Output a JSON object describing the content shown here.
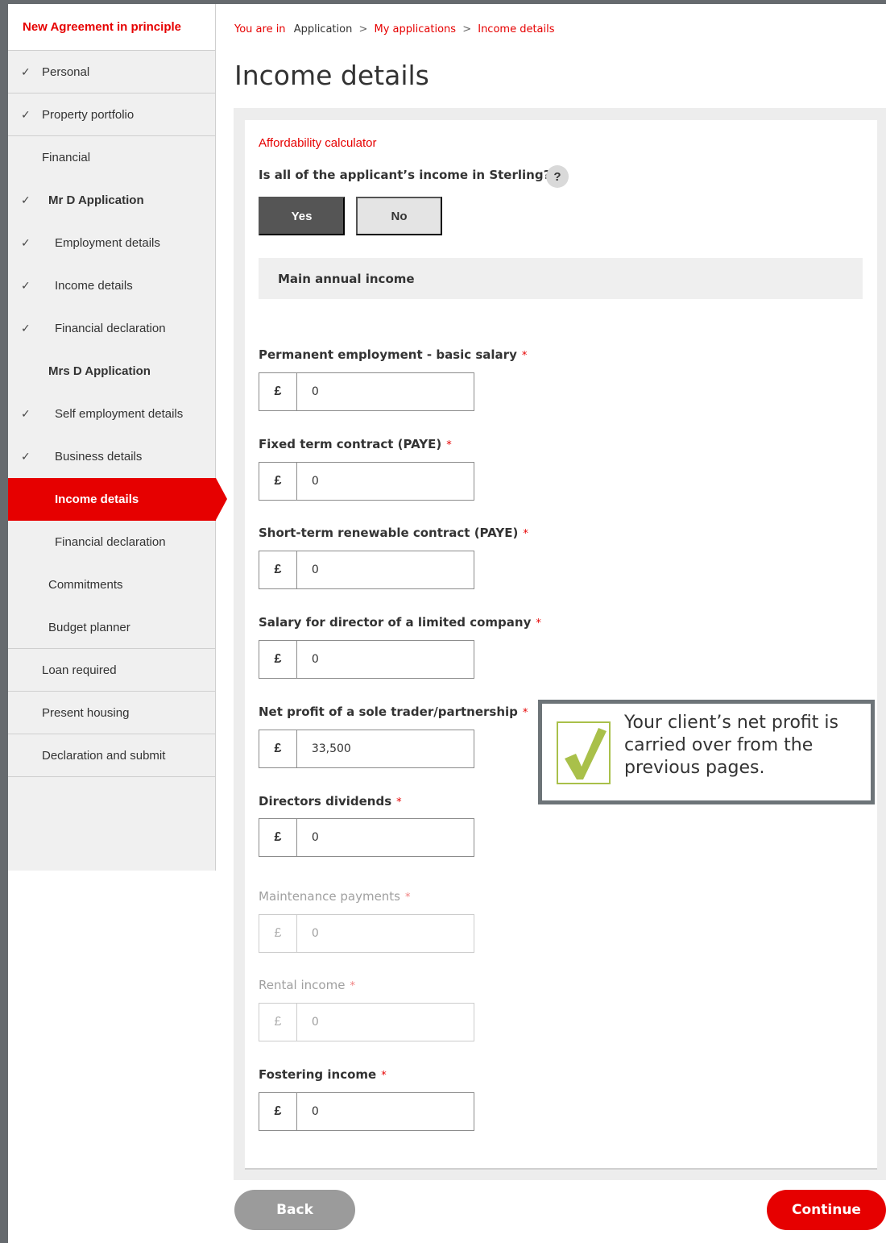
{
  "sidebar": {
    "title": "New Agreement in principle",
    "items": [
      {
        "label": "Personal",
        "checked": true
      },
      {
        "label": "Property portfolio",
        "checked": true
      },
      {
        "label": "Financial",
        "checked": false
      },
      {
        "label": "Mr D Application",
        "checked": true
      },
      {
        "label": "Employment details",
        "checked": true
      },
      {
        "label": "Income details",
        "checked": true
      },
      {
        "label": "Financial declaration",
        "checked": true
      },
      {
        "label": "Mrs D Application",
        "checked": false
      },
      {
        "label": "Self employment details",
        "checked": true
      },
      {
        "label": "Business details",
        "checked": true
      },
      {
        "label": "Income details",
        "checked": false,
        "active": true
      },
      {
        "label": "Financial declaration",
        "checked": false
      },
      {
        "label": "Commitments",
        "checked": false
      },
      {
        "label": "Budget planner",
        "checked": false
      },
      {
        "label": "Loan required",
        "checked": false
      },
      {
        "label": "Present housing",
        "checked": false
      },
      {
        "label": "Declaration and submit",
        "checked": false
      }
    ],
    "check_symbol": "✓"
  },
  "breadcrumb": {
    "prefix": "You are in",
    "items": [
      "Application",
      "My applications",
      "Income details"
    ],
    "separator": ">"
  },
  "page": {
    "title": "Income details"
  },
  "form": {
    "section_label": "Affordability calculator",
    "sterling_question": "Is all of the applicant’s income in Sterling?",
    "required_mark": "*",
    "help_symbol": "?",
    "yes_label": "Yes",
    "no_label": "No",
    "selected": "Yes",
    "main_income_heading": "Main annual income",
    "currency_symbol": "£",
    "fields": [
      {
        "label": "Permanent employment - basic salary",
        "value": "0",
        "disabled": false
      },
      {
        "label": "Fixed term contract (PAYE)",
        "value": "0",
        "disabled": false
      },
      {
        "label": "Short-term renewable contract (PAYE)",
        "value": "0",
        "disabled": false
      },
      {
        "label": "Salary for director of a limited company",
        "value": "0",
        "disabled": false
      },
      {
        "label": "Net profit of a sole trader/partnership",
        "value": "33,500",
        "disabled": false
      },
      {
        "label": "Directors dividends",
        "value": "0",
        "disabled": false
      },
      {
        "label": "Maintenance payments",
        "value": "0",
        "disabled": true
      },
      {
        "label": "Rental income",
        "value": "0",
        "disabled": true
      },
      {
        "label": "Fostering income",
        "value": "0",
        "disabled": false
      }
    ]
  },
  "callout": {
    "text": "Your client’s net profit is carried over from the previous pages.",
    "accent_color": "#a9c04a",
    "border_color": "#6d7478"
  },
  "actions": {
    "back_label": "Back",
    "continue_label": "Continue"
  },
  "colors": {
    "brand_red": "#e60000",
    "frame_grey": "#666a6e",
    "yes_active": "#555555"
  }
}
